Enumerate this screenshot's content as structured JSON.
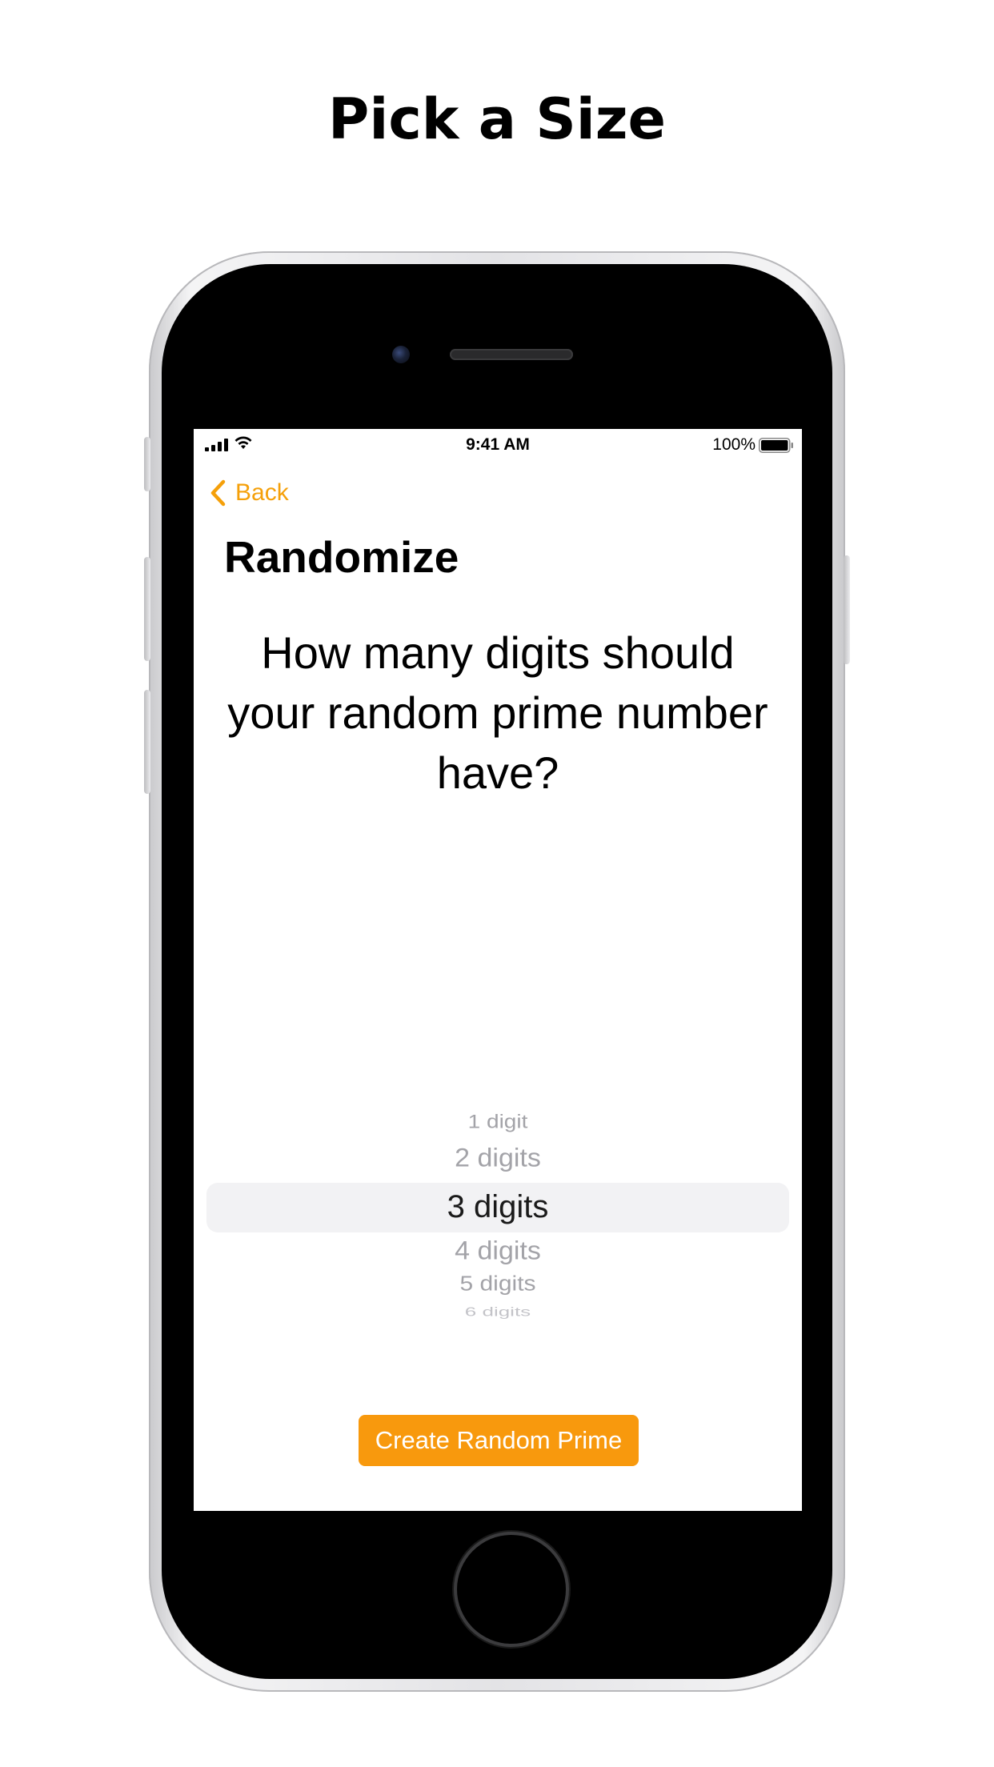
{
  "headline": "Pick a Size",
  "status_bar": {
    "time": "9:41 AM",
    "battery_percent": "100%"
  },
  "nav": {
    "back_label": "Back",
    "title": "Randomize"
  },
  "question": "How many digits should your random prime number have?",
  "picker": {
    "items": [
      "1 digit",
      "2 digits",
      "3 digits",
      "4 digits",
      "5 digits",
      "6 digits"
    ],
    "selected": "3 digits"
  },
  "create_button_label": "Create Random Prime",
  "colors": {
    "accent": "#F5A00A",
    "button": "#F8990D"
  }
}
